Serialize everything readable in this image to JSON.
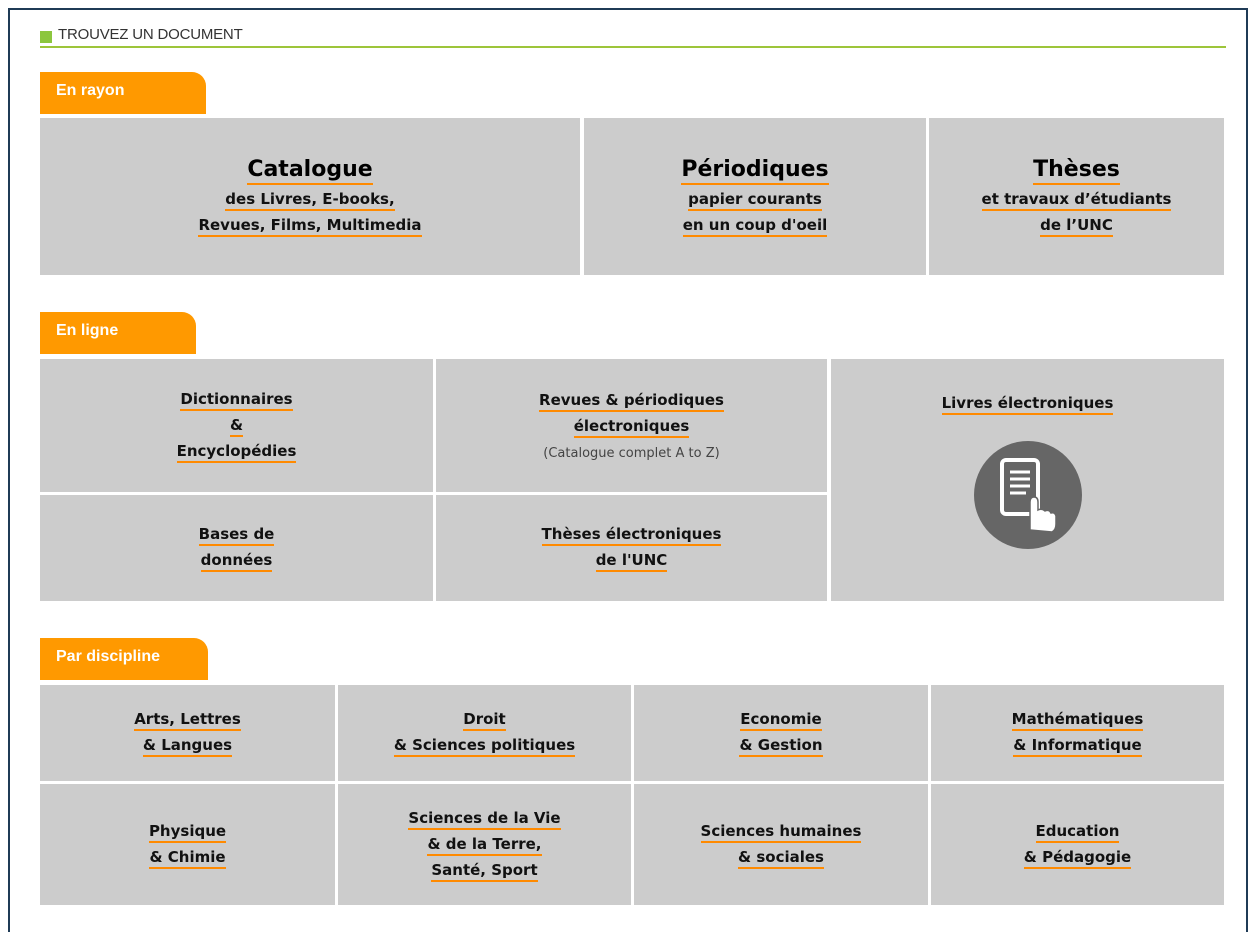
{
  "header": {
    "title": "TROUVEZ UN DOCUMENT"
  },
  "en_rayon": {
    "tab": "En rayon",
    "catalogue": {
      "title": "Catalogue",
      "line1": "des Livres, E-books,",
      "line2": "Revues, Films, Multimedia"
    },
    "periodiques": {
      "title": "Périodiques",
      "line1": "papier courants",
      "line2": "en un coup d'oeil"
    },
    "theses": {
      "title": "Thèses",
      "line1": "et travaux d’étudiants",
      "line2": "de l’UNC"
    }
  },
  "en_ligne": {
    "tab": "En ligne",
    "dictionnaires": {
      "line1": "Dictionnaires",
      "line2": "&",
      "line3": "Encyclopédies"
    },
    "revues": {
      "line1": "Revues & périodiques",
      "line2": "électroniques",
      "note": "(Catalogue complet A to Z)"
    },
    "livres": {
      "label": "Livres électroniques",
      "icon": "ebook-touch-icon"
    },
    "bases": {
      "line1": "Bases de",
      "line2": "données"
    },
    "theses_elec": {
      "line1": "Thèses électroniques",
      "line2": "de l'UNC"
    }
  },
  "par_discipline": {
    "tab": "Par discipline",
    "items": [
      {
        "line1": "Arts, Lettres",
        "line2": "& Langues",
        "line3": ""
      },
      {
        "line1": "Droit",
        "line2": "& Sciences politiques",
        "line3": ""
      },
      {
        "line1": "Economie",
        "line2": "& Gestion",
        "line3": ""
      },
      {
        "line1": "Mathématiques",
        "line2": "& Informatique",
        "line3": ""
      },
      {
        "line1": "Physique",
        "line2": "& Chimie",
        "line3": ""
      },
      {
        "line1": "Sciences de la Vie",
        "line2": "& de la Terre,",
        "line3": "Santé, Sport"
      },
      {
        "line1": "Sciences humaines",
        "line2": "& sociales",
        "line3": ""
      },
      {
        "line1": "Education",
        "line2": "& Pédagogie",
        "line3": ""
      }
    ]
  },
  "colors": {
    "accent_orange": "#ff9900",
    "tile_gray": "#cccccc",
    "header_green": "#8cc63e"
  }
}
